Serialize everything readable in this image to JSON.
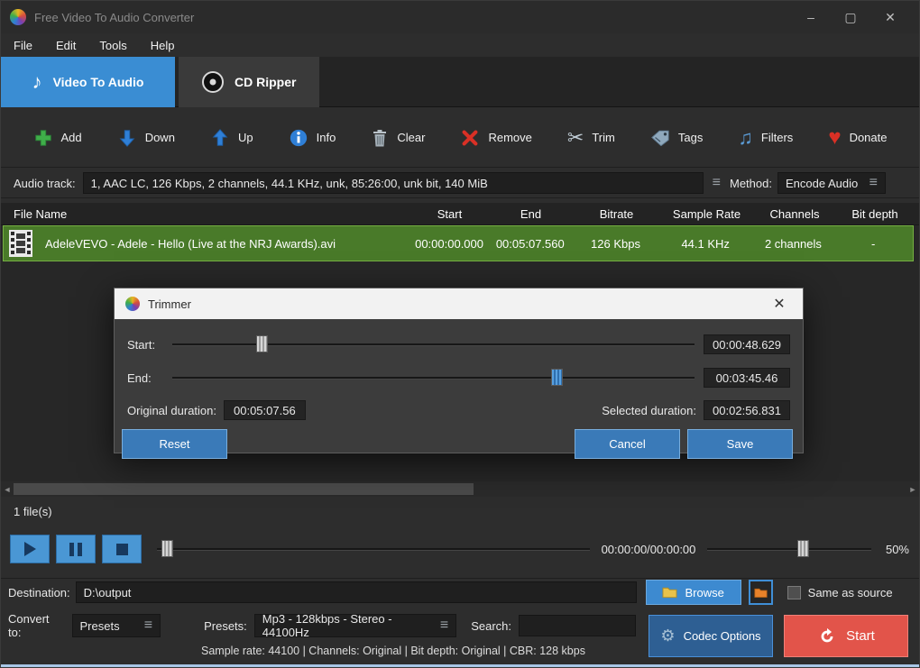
{
  "window": {
    "title": "Free Video To Audio Converter",
    "minimize": "–",
    "maximize": "▢",
    "close": "✕"
  },
  "menu": {
    "items": [
      "File",
      "Edit",
      "Tools",
      "Help"
    ]
  },
  "tabs": {
    "video_to_audio": "Video To Audio",
    "cd_ripper": "CD Ripper"
  },
  "toolbar": {
    "add": "Add",
    "down": "Down",
    "up": "Up",
    "info": "Info",
    "clear": "Clear",
    "remove": "Remove",
    "trim": "Trim",
    "tags": "Tags",
    "filters": "Filters",
    "donate": "Donate"
  },
  "audio_track": {
    "label": "Audio track:",
    "value": "1, AAC LC, 126 Kbps, 2 channels, 44.1 KHz, unk, 85:26:00, unk bit, 140 MiB",
    "method_label": "Method:",
    "method_value": "Encode Audio"
  },
  "table": {
    "headers": [
      "File Name",
      "Start",
      "End",
      "Bitrate",
      "Sample Rate",
      "Channels",
      "Bit depth"
    ],
    "row": {
      "name": "AdeleVEVO - Adele - Hello (Live at the NRJ Awards).avi",
      "start": "00:00:00.000",
      "end": "00:05:07.560",
      "bitrate": "126 Kbps",
      "sample_rate": "44.1 KHz",
      "channels": "2 channels",
      "bit_depth": "-"
    }
  },
  "trimmer": {
    "title": "Trimmer",
    "close": "✕",
    "start_label": "Start:",
    "start_value": "00:00:48.629",
    "end_label": "End:",
    "end_value": "00:03:45.46",
    "start_slider_percent": 16,
    "end_slider_percent": 72.5,
    "original_duration_label": "Original duration:",
    "original_duration_value": "00:05:07.56",
    "selected_duration_label": "Selected duration:",
    "selected_duration_value": "00:02:56.831",
    "reset": "Reset",
    "cancel": "Cancel",
    "save": "Save"
  },
  "status_bar": {
    "files": "1 file(s)"
  },
  "player": {
    "time": "00:00:00/00:00:00",
    "volume_percent": "50%",
    "progress_percent": 1,
    "volume_slider_percent": 55
  },
  "destination": {
    "label": "Destination:",
    "path": "D:\\output",
    "browse": "Browse",
    "same_as_source": "Same as source"
  },
  "convert": {
    "convert_to_label": "Convert to:",
    "category": "Presets",
    "presets_label": "Presets:",
    "preset": "Mp3 - 128kbps - Stereo - 44100Hz",
    "search_label": "Search:",
    "search_value": "",
    "codec_options": "Codec Options",
    "start": "Start"
  },
  "footer": {
    "summary": "Sample rate: 44100 | Channels: Original | Bit depth: Original | CBR: 128 kbps"
  },
  "icons": {
    "hamburger": "≡",
    "scroll_left": "◄",
    "scroll_right": "►",
    "gear": "⚙",
    "scissors": "✂",
    "heart": "♥",
    "note": "♪",
    "notes": "♫"
  },
  "colors": {
    "accent_blue": "#3a8dd3",
    "selected_green": "#497a29",
    "start_red": "#e2544a"
  }
}
